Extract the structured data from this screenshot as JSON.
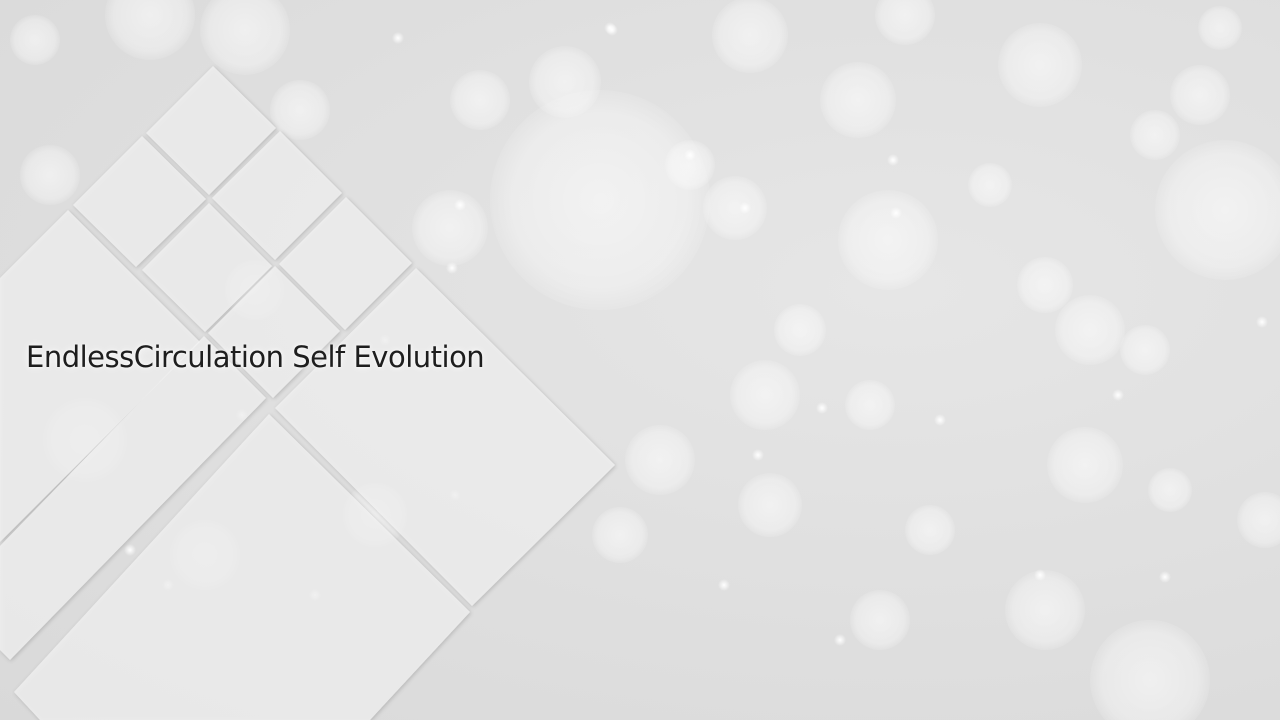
{
  "slide": {
    "headline": "EndlessCirculation Self Evolution"
  },
  "theme": {
    "background": "#e2e2e2",
    "tile_fill": "#f2f2f2",
    "text_color": "#1e1e1e"
  }
}
